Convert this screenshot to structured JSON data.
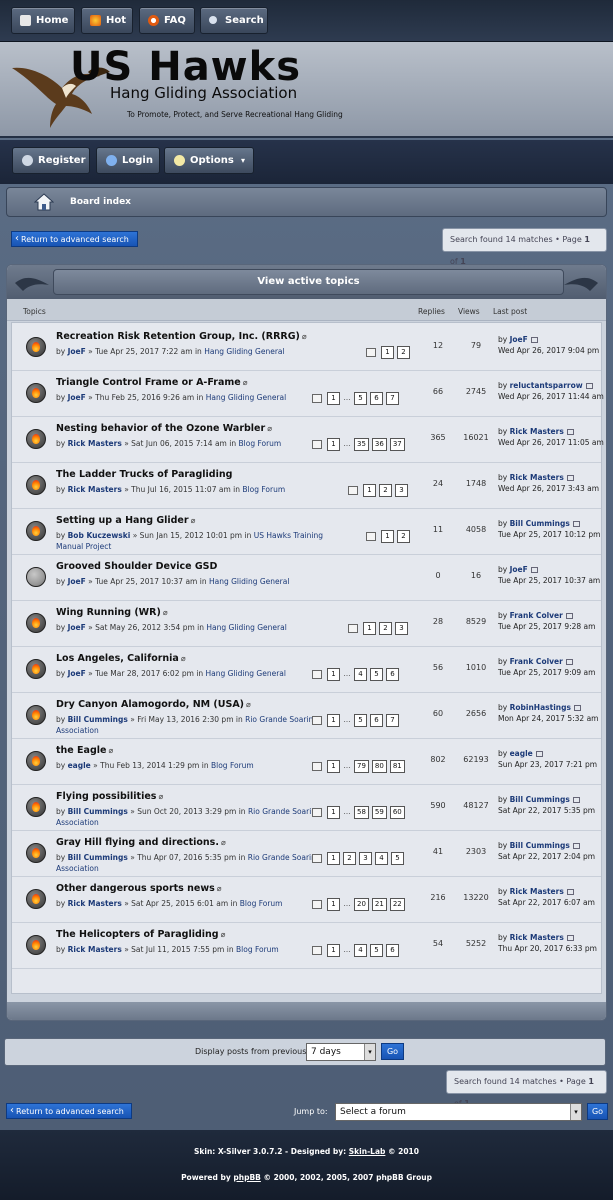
{
  "topnav": [
    {
      "label": "Home",
      "icon": "home-icon"
    },
    {
      "label": "Hot",
      "icon": "fire-icon"
    },
    {
      "label": "FAQ",
      "icon": "lifebuoy-icon"
    },
    {
      "label": "Search",
      "icon": "search-icon"
    }
  ],
  "header": {
    "title": "US Hawks",
    "subtitle": "Hang Gliding Association",
    "tagline": "To Promote, Protect, and Serve Recreational Hang Gliding"
  },
  "usernav": [
    {
      "label": "Register",
      "icon": "register-icon"
    },
    {
      "label": "Login",
      "icon": "user-icon"
    },
    {
      "label": "Options",
      "icon": "bulb-icon"
    }
  ],
  "breadcrumb": {
    "label": "Board index"
  },
  "return_label": "Return to advanced search",
  "search_info": {
    "prefix": "Search found 14 matches • Page ",
    "page": "1",
    "mid": " of ",
    "total": "1"
  },
  "panel": {
    "title": "View active topics",
    "columns": {
      "topics": "Topics",
      "replies": "Replies",
      "views": "Views",
      "last_post": "Last post"
    }
  },
  "topics": [
    {
      "title": "Recreation Risk Retention Group, Inc. (RRRG)",
      "attach": true,
      "by": "by",
      "author": "JoeF",
      "date": "Tue Apr 25, 2017 7:22 am",
      "in": "in",
      "forum": "Hang Gliding General",
      "pages": [
        "1",
        "2"
      ],
      "replies": "12",
      "views": "79",
      "lp_author": "JoeF",
      "lp_date": "Wed Apr 26, 2017 9:04 pm",
      "hot": true
    },
    {
      "title": "Triangle Control Frame or A-Frame",
      "attach": true,
      "by": "by",
      "author": "JoeF",
      "date": "Thu Feb 25, 2016 9:26 am",
      "in": "in",
      "forum": "Hang Gliding General",
      "pages": [
        "1",
        "…",
        "5",
        "6",
        "7"
      ],
      "replies": "66",
      "views": "2745",
      "lp_author": "reluctantsparrow",
      "lp_date": "Wed Apr 26, 2017 11:44 am",
      "hot": true
    },
    {
      "title": "Nesting behavior of the Ozone Warbler",
      "attach": true,
      "by": "by",
      "author": "Rick Masters",
      "date": "Sat Jun 06, 2015 7:14 am",
      "in": "in",
      "forum": "Blog Forum",
      "pages": [
        "1",
        "…",
        "35",
        "36",
        "37"
      ],
      "replies": "365",
      "views": "16021",
      "lp_author": "Rick Masters",
      "lp_date": "Wed Apr 26, 2017 11:05 am",
      "hot": true
    },
    {
      "title": "The Ladder Trucks of Paragliding",
      "attach": false,
      "by": "by",
      "author": "Rick Masters",
      "date": "Thu Jul 16, 2015 11:07 am",
      "in": "in",
      "forum": "Blog Forum",
      "pages": [
        "1",
        "2",
        "3"
      ],
      "replies": "24",
      "views": "1748",
      "lp_author": "Rick Masters",
      "lp_date": "Wed Apr 26, 2017 3:43 am",
      "hot": true
    },
    {
      "title": "Setting up a Hang Glider",
      "attach": true,
      "by": "by",
      "author": "Bob Kuczewski",
      "date": "Sun Jan 15, 2012 10:01 pm",
      "in": "in",
      "forum": "US Hawks Training Manual Project",
      "pages": [
        "1",
        "2"
      ],
      "replies": "11",
      "views": "4058",
      "lp_author": "Bill Cummings",
      "lp_date": "Tue Apr 25, 2017 10:12 pm",
      "hot": true
    },
    {
      "title": "Grooved Shoulder Device GSD",
      "attach": false,
      "by": "by",
      "author": "JoeF",
      "date": "Tue Apr 25, 2017 10:37 am",
      "in": "in",
      "forum": "Hang Gliding General",
      "pages": [],
      "replies": "0",
      "views": "16",
      "lp_author": "JoeF",
      "lp_date": "Tue Apr 25, 2017 10:37 am",
      "hot": false
    },
    {
      "title": "Wing Running (WR)",
      "attach": true,
      "by": "by",
      "author": "JoeF",
      "date": "Sat May 26, 2012 3:54 pm",
      "in": "in",
      "forum": "Hang Gliding General",
      "pages": [
        "1",
        "2",
        "3"
      ],
      "replies": "28",
      "views": "8529",
      "lp_author": "Frank Colver",
      "lp_date": "Tue Apr 25, 2017 9:28 am",
      "hot": true
    },
    {
      "title": "Los Angeles, California",
      "attach": true,
      "by": "by",
      "author": "JoeF",
      "date": "Tue Mar 28, 2017 6:02 pm",
      "in": "in",
      "forum": "Hang Gliding General",
      "pages": [
        "1",
        "…",
        "4",
        "5",
        "6"
      ],
      "replies": "56",
      "views": "1010",
      "lp_author": "Frank Colver",
      "lp_date": "Tue Apr 25, 2017 9:09 am",
      "hot": true
    },
    {
      "title": "Dry Canyon Alamogordo, NM (USA)",
      "attach": true,
      "by": "by",
      "author": "Bill Cummings",
      "date": "Fri May 13, 2016 2:30 pm",
      "in": "in",
      "forum": "Rio Grande Soaring Association",
      "pages": [
        "1",
        "…",
        "5",
        "6",
        "7"
      ],
      "replies": "60",
      "views": "2656",
      "lp_author": "RobinHastings",
      "lp_date": "Mon Apr 24, 2017 5:32 am",
      "hot": true
    },
    {
      "title": "the Eagle",
      "attach": true,
      "by": "by",
      "author": "eagle",
      "date": "Thu Feb 13, 2014 1:29 pm",
      "in": "in",
      "forum": "Blog Forum",
      "pages": [
        "1",
        "…",
        "79",
        "80",
        "81"
      ],
      "replies": "802",
      "views": "62193",
      "lp_author": "eagle",
      "lp_date": "Sun Apr 23, 2017 7:21 pm",
      "hot": true
    },
    {
      "title": "Flying possibilities",
      "attach": true,
      "by": "by",
      "author": "Bill Cummings",
      "date": "Sun Oct 20, 2013 3:29 pm",
      "in": "in",
      "forum": "Rio Grande Soaring Association",
      "pages": [
        "1",
        "…",
        "58",
        "59",
        "60"
      ],
      "replies": "590",
      "views": "48127",
      "lp_author": "Bill Cummings",
      "lp_date": "Sat Apr 22, 2017 5:35 pm",
      "hot": true
    },
    {
      "title": "Gray Hill flying and directions.",
      "attach": true,
      "by": "by",
      "author": "Bill Cummings",
      "date": "Thu Apr 07, 2016 5:35 pm",
      "in": "in",
      "forum": "Rio Grande Soaring Association",
      "pages": [
        "1",
        "2",
        "3",
        "4",
        "5"
      ],
      "replies": "41",
      "views": "2303",
      "lp_author": "Bill Cummings",
      "lp_date": "Sat Apr 22, 2017 2:04 pm",
      "hot": true
    },
    {
      "title": "Other dangerous sports news",
      "attach": true,
      "by": "by",
      "author": "Rick Masters",
      "date": "Sat Apr 25, 2015 6:01 am",
      "in": "in",
      "forum": "Blog Forum",
      "pages": [
        "1",
        "…",
        "20",
        "21",
        "22"
      ],
      "replies": "216",
      "views": "13220",
      "lp_author": "Rick Masters",
      "lp_date": "Sat Apr 22, 2017 6:07 am",
      "hot": true
    },
    {
      "title": "The Helicopters of Paragliding",
      "attach": true,
      "by": "by",
      "author": "Rick Masters",
      "date": "Sat Jul 11, 2015 7:55 pm",
      "in": "in",
      "forum": "Blog Forum",
      "pages": [
        "1",
        "…",
        "4",
        "5",
        "6"
      ],
      "replies": "54",
      "views": "5252",
      "lp_author": "Rick Masters",
      "lp_date": "Thu Apr 20, 2017 6:33 pm",
      "hot": true
    }
  ],
  "display": {
    "label": "Display posts from previous",
    "value": "7 days",
    "go": "Go"
  },
  "jump": {
    "label": "Jump to:",
    "value": "Select a forum",
    "go": "Go"
  },
  "footer": {
    "skin_text": "Skin: X-Silver 3.0.7.2 - Designed by: ",
    "skin_link": "Skin-Lab",
    "skin_year": " © 2010",
    "powered_text": "Powered by ",
    "powered_link": "phpBB",
    "powered_rest": " © 2000, 2002, 2005, 2007 phpBB Group"
  },
  "colors": {
    "accent": "#1c3a78",
    "button_blue": "#1e5fc4",
    "nav_dark": "#1f2a3a"
  }
}
